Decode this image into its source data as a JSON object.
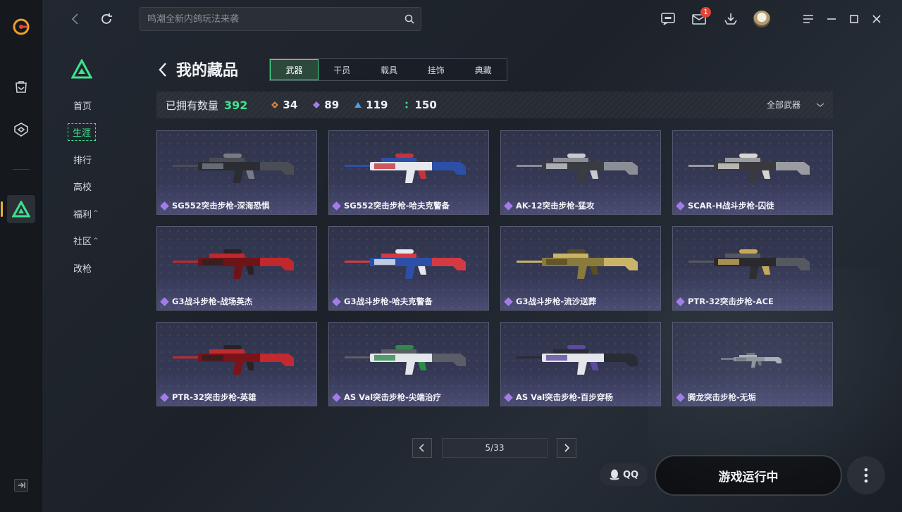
{
  "search": {
    "placeholder": "鸣潮全新内鸽玩法来袭"
  },
  "notifications": {
    "mail_badge": "1"
  },
  "subnav": {
    "items": [
      {
        "label": "首页",
        "caret": ""
      },
      {
        "label": "生涯",
        "caret": ""
      },
      {
        "label": "排行",
        "caret": ""
      },
      {
        "label": "高校",
        "caret": ""
      },
      {
        "label": "福利",
        "caret": "^"
      },
      {
        "label": "社区",
        "caret": "^"
      },
      {
        "label": "改枪",
        "caret": ""
      }
    ],
    "active": "生涯"
  },
  "page": {
    "title": "我的藏品"
  },
  "tabs": [
    {
      "label": "武器",
      "active": true
    },
    {
      "label": "干员",
      "active": false
    },
    {
      "label": "载具",
      "active": false
    },
    {
      "label": "挂饰",
      "active": false
    },
    {
      "label": "典藏",
      "active": false
    }
  ],
  "stats": {
    "owned_label": "已拥有数量",
    "owned_count": "392",
    "rarities": [
      {
        "value": "34",
        "color": "#e0823a"
      },
      {
        "value": "89",
        "color": "#a47be8"
      },
      {
        "value": "119",
        "color": "#4a9ee8"
      },
      {
        "value": "150",
        "color": "#3ee38f"
      }
    ],
    "filter_label": "全部武器"
  },
  "items": [
    {
      "name": "SG552突击步枪-深海恐惧",
      "palette": [
        "#2b2d33",
        "#4a4d55",
        "#777b85"
      ]
    },
    {
      "name": "SG552突击步枪-哈夫克警备",
      "palette": [
        "#e6e8ee",
        "#2d4fa8",
        "#c2343a"
      ]
    },
    {
      "name": "AK-12突击步枪-猛攻",
      "palette": [
        "#3a3c42",
        "#8b8e95",
        "#c8cad0"
      ]
    },
    {
      "name": "SCAR-H战斗步枪-囚徒",
      "palette": [
        "#3a3a3e",
        "#9a9ca2",
        "#d9d6cf"
      ]
    },
    {
      "name": "G3战斗步枪-战场英杰",
      "palette": [
        "#6e1418",
        "#c0282e",
        "#2a2226"
      ]
    },
    {
      "name": "G3战斗步枪-哈夫克警备",
      "palette": [
        "#2d4fa8",
        "#d43a44",
        "#e6e8ee"
      ]
    },
    {
      "name": "G3战斗步枪-流沙送葬",
      "palette": [
        "#8a7a3c",
        "#c9b46a",
        "#5a4c24"
      ]
    },
    {
      "name": "PTR-32突击步枪-ACE",
      "palette": [
        "#2a2a2e",
        "#565860",
        "#c8a85a"
      ]
    },
    {
      "name": "PTR-32突击步枪-英雄",
      "palette": [
        "#7a1418",
        "#c22a30",
        "#2a2226"
      ]
    },
    {
      "name": "AS Val突击步枪-尖端治疗",
      "palette": [
        "#e4e6ea",
        "#5b5e66",
        "#2f8a4a"
      ]
    },
    {
      "name": "AS Val突击步枪-百步穿杨",
      "palette": [
        "#e4e6ea",
        "#2a2c34",
        "#5c4a9e"
      ]
    },
    {
      "name": "腾龙突击步枪-无垢",
      "palette": [
        "#8e949c",
        "#aab0b8",
        "#6a7078"
      ]
    }
  ],
  "pager": {
    "text": "5/33"
  },
  "bottom": {
    "qq_label": "QQ",
    "launch_label": "游戏运行中"
  }
}
